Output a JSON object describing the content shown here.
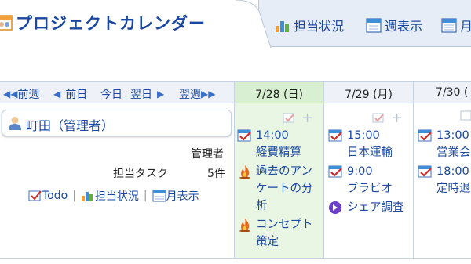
{
  "header": {
    "title": "プロジェクトカレンダー",
    "nav": [
      {
        "label": "担当状況",
        "icon": "bar-chart-icon"
      },
      {
        "label": "週表示",
        "icon": "calendar-week-icon"
      },
      {
        "label": "月",
        "icon": "calendar-month-icon"
      }
    ]
  },
  "navigation": {
    "prev_week": "前週",
    "prev_day": "前日",
    "today": "今日",
    "next_day": "翌日",
    "next_week": "翌週"
  },
  "days": [
    {
      "label": "7/28 (日)"
    },
    {
      "label": "7/29 (月)"
    },
    {
      "label": "7/30 ("
    }
  ],
  "user": {
    "name": "町田（管理者）",
    "role": "管理者",
    "task_label": "担当タスク",
    "task_count": "5件",
    "links": [
      "Todo",
      "担当状況",
      "月表示"
    ]
  },
  "events": {
    "day0": [
      {
        "time": "14:00",
        "title": "経費精算",
        "icon": "schedule-icon"
      },
      {
        "lines": [
          "過去のアン",
          "ケートの分",
          "析"
        ],
        "icon": "flame-icon"
      },
      {
        "lines": [
          "コンセプト",
          "策定"
        ],
        "icon": "flame-icon"
      }
    ],
    "day1": [
      {
        "time": "15:00",
        "title": "日本運輸",
        "icon": "schedule-icon"
      },
      {
        "time": "9:00",
        "title": "ブラビオ",
        "icon": "schedule-icon"
      },
      {
        "title": "シェア調査",
        "icon": "arrow-circle-icon"
      }
    ],
    "day2": [
      {
        "time": "13:00",
        "title": "営業会",
        "icon": "schedule-icon"
      },
      {
        "time": "18:00",
        "title": "定時退",
        "icon": "schedule-icon"
      }
    ]
  },
  "colors": {
    "link": "#1a47a0",
    "today_bg": "#e8f6e3",
    "header_bg": "#eef2f8",
    "border": "#c7d2e0"
  }
}
